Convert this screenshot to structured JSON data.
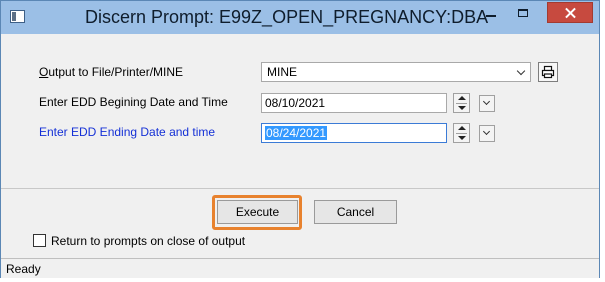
{
  "window": {
    "title": "Discern Prompt: E99Z_OPEN_PREGNANCY:DBA"
  },
  "prompts": {
    "output": {
      "label_accesskey": "O",
      "label_rest": "utput to File/Printer/MINE",
      "value": "MINE"
    },
    "edd_begin": {
      "label": "Enter EDD Begining Date and Time",
      "value": "08/10/2021"
    },
    "edd_end": {
      "label": "Enter EDD Ending Date and time",
      "value": "08/24/2021"
    }
  },
  "buttons": {
    "execute": "Execute",
    "cancel": "Cancel"
  },
  "return_checkbox": {
    "label": "Return to prompts on close of output",
    "checked": false
  },
  "status_bar": {
    "text": "Ready"
  },
  "colors": {
    "titlebar": "#9bbfe6",
    "close_button": "#c74a3f",
    "active_label": "#1430d6",
    "highlight": "#e8822e",
    "selection": "#3399ff"
  }
}
